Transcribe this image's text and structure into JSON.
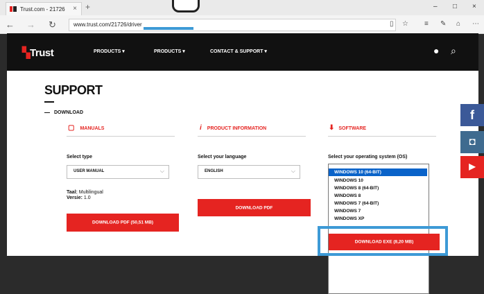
{
  "browser": {
    "tab_title": "Trust.com - 21726",
    "url": "www.trust.com/21726/driver",
    "new_tab": "+",
    "tab_close": "×",
    "back": "←",
    "forward": "→",
    "refresh": "↻",
    "win_minimize": "–",
    "win_maximize": "□",
    "win_close": "×",
    "toolbar_icons": [
      "reading-view-icon",
      "favorite-icon",
      "hub-icon",
      "note-icon",
      "share-icon",
      "more-icon"
    ]
  },
  "site": {
    "logo": "Trust",
    "menu": [
      "PRODUCTS",
      "PRODUCTS",
      "CONTACT & SUPPORT"
    ],
    "accent": "#e52421",
    "header_bg": "#111111"
  },
  "page": {
    "title": "SUPPORT",
    "section": "DOWNLOAD"
  },
  "columns": {
    "manuals": {
      "header": "MANUALS",
      "select_label": "Select type",
      "select_value": "USER MANUAL",
      "meta_lang_label": "Taal:",
      "meta_lang": "Multilingual",
      "meta_version_label": "Versie:",
      "meta_version": "1.0",
      "button": "DOWNLOAD PDF (50,51 MB)"
    },
    "product_info": {
      "header": "PRODUCT INFORMATION",
      "select_label": "Select your language",
      "select_value": "ENGLISH",
      "button": "DOWNLOAD PDF"
    },
    "software": {
      "header": "SOFTWARE",
      "select_label": "Select your operating system (OS)",
      "os_options": [
        "WINDOWS 10 (64-BIT)",
        "WINDOWS 10",
        "WINDOWS 8 (64-BIT)",
        "WINDOWS 8",
        "WINDOWS 7 (64-BIT)",
        "WINDOWS 7",
        "WINDOWS XP"
      ],
      "selected_option": "WINDOWS 10 (64-BIT)",
      "button": "DOWNLOAD EXE (8,20 MB)"
    }
  },
  "social": [
    {
      "icon": "facebook-icon",
      "glyph": "f",
      "color": "#3b5998"
    },
    {
      "icon": "instagram-icon",
      "glyph": "◘",
      "color": "#3f6b8f"
    },
    {
      "icon": "youtube-icon",
      "glyph": "▶",
      "color": "#e52421"
    }
  ]
}
